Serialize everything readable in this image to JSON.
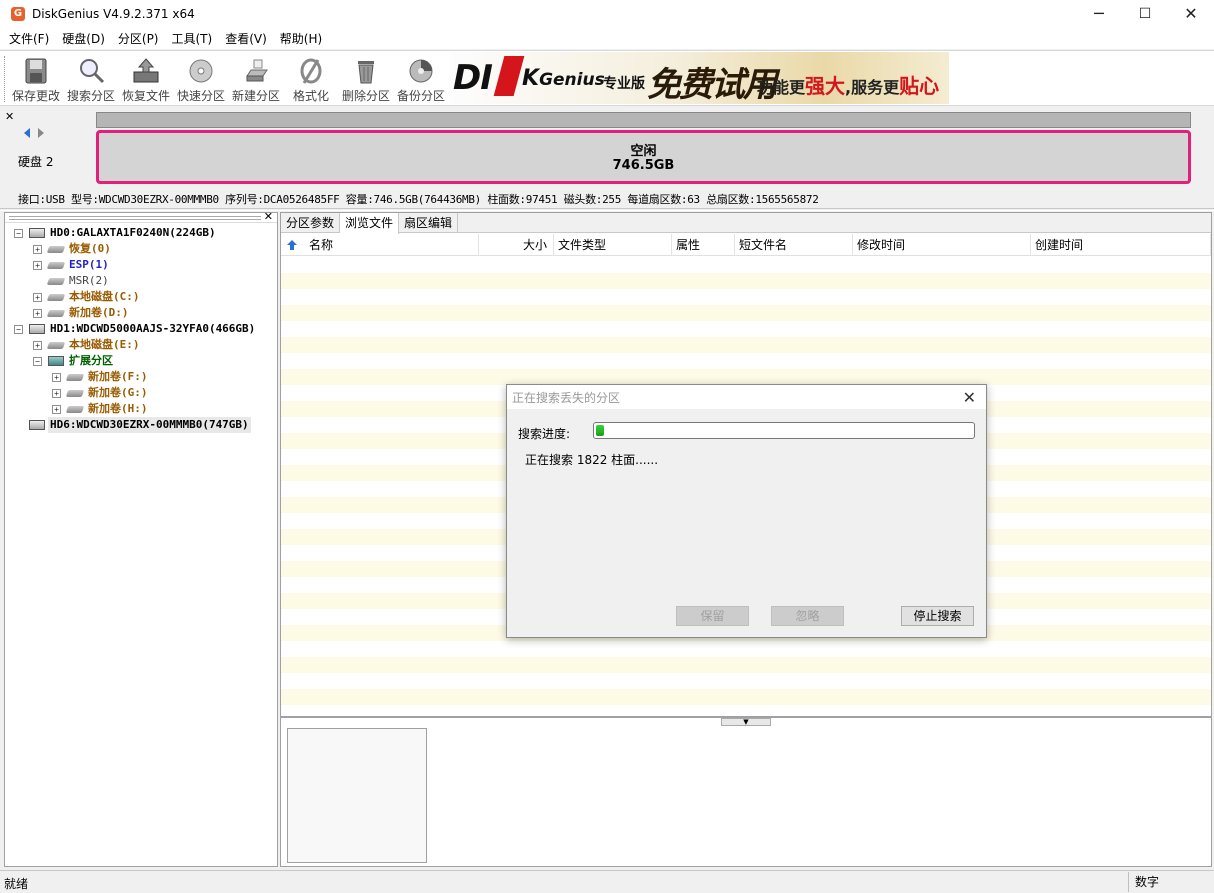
{
  "window": {
    "title": "DiskGenius V4.9.2.371 x64",
    "minimize": "─",
    "maximize": "☐",
    "close": "✕"
  },
  "menu": [
    "文件(F)",
    "硬盘(D)",
    "分区(P)",
    "工具(T)",
    "查看(V)",
    "帮助(H)"
  ],
  "toolbar": {
    "buttons": [
      "保存更改",
      "搜索分区",
      "恢复文件",
      "快速分区",
      "新建分区",
      "格式化",
      "删除分区",
      "备份分区"
    ]
  },
  "banner": {
    "logo_a": "DI",
    "logo_b": "K",
    "logo_c": "Genius",
    "edition": "专业版",
    "trial": "免费试用",
    "slogan_a": "功能更",
    "slogan_b": "强大",
    "slogan_c": ",服务更",
    "slogan_d": "贴心"
  },
  "disk": {
    "close": "✕",
    "label": "硬盘 2",
    "free_label": "空闲",
    "free_size": "746.5GB",
    "info": "接口:USB  型号:WDCWD30EZRX-00MMMB0  序列号:DCA0526485FF  容量:746.5GB(764436MB)  柱面数:97451  磁头数:255  每道扇区数:63  总扇区数:1565565872"
  },
  "tree": {
    "close": "✕",
    "items": [
      {
        "label": "HD0:GALAXTA1F0240N(224GB)",
        "color": "#000000"
      },
      {
        "label": "恢复(0)",
        "color": "#9a5b00"
      },
      {
        "label": "ESP(1)",
        "color": "#2020d0"
      },
      {
        "label": "MSR(2)",
        "color": "#444444"
      },
      {
        "label": "本地磁盘(C:)",
        "color": "#9a5b00"
      },
      {
        "label": "新加卷(D:)",
        "color": "#9a5b00"
      },
      {
        "label": "HD1:WDCWD5000AAJS-32YFA0(466GB)",
        "color": "#000000"
      },
      {
        "label": "本地磁盘(E:)",
        "color": "#9a5b00"
      },
      {
        "label": "扩展分区",
        "color": "#006000"
      },
      {
        "label": "新加卷(F:)",
        "color": "#9a5b00"
      },
      {
        "label": "新加卷(G:)",
        "color": "#9a5b00"
      },
      {
        "label": "新加卷(H:)",
        "color": "#9a5b00"
      },
      {
        "label": "HD6:WDCWD30EZRX-00MMMB0(747GB)",
        "color": "#000000"
      }
    ]
  },
  "tabs": [
    "分区参数",
    "浏览文件",
    "扇区编辑"
  ],
  "columns": [
    "名称",
    "大小",
    "文件类型",
    "属性",
    "短文件名",
    "修改时间",
    "创建时间"
  ],
  "dialog": {
    "title": "正在搜索丢失的分区",
    "close": "✕",
    "progress_label": "搜索进度:",
    "progress": 0.02,
    "status": "正在搜索 1822 柱面......",
    "keep": "保留",
    "ignore": "忽略",
    "stop": "停止搜索"
  },
  "status": {
    "left": "就绪",
    "right": "数字"
  }
}
